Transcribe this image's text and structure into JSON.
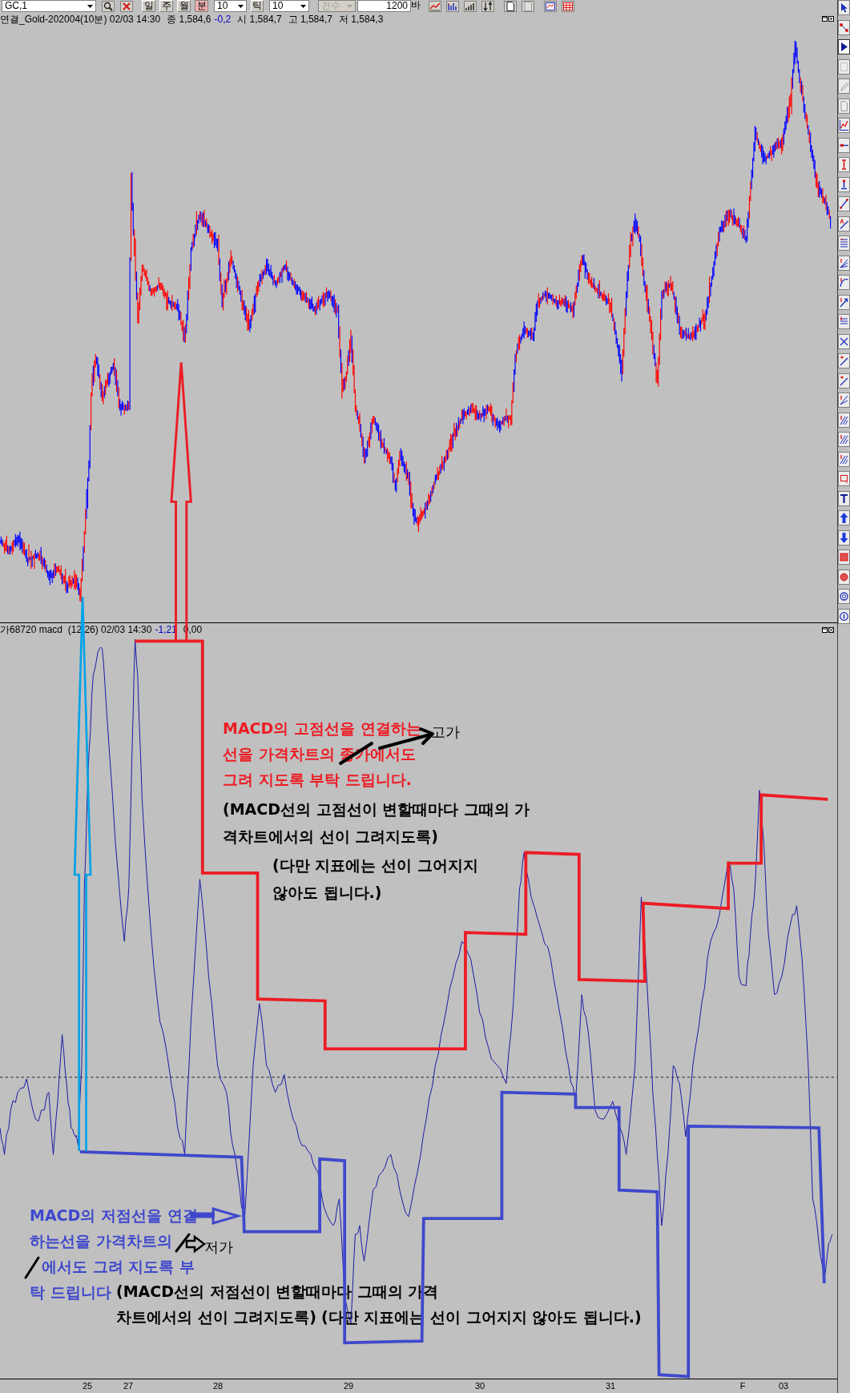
{
  "toolbar": {
    "symbol": "GC,1",
    "periods": [
      {
        "label": "일",
        "selected": false
      },
      {
        "label": "주",
        "selected": false
      },
      {
        "label": "월",
        "selected": false
      },
      {
        "label": "분",
        "selected": true
      }
    ],
    "interval": "10",
    "tick_label": "틱",
    "tick_count": "10",
    "count_mode": {
      "label": "건수",
      "disabled": true
    },
    "bar_count": "1200",
    "bar_unit": "바"
  },
  "price_panel": {
    "title": "연결_Gold-202004(10분) 02/03 14:30",
    "close": {
      "label": "종",
      "value": "1,584,6",
      "change": "-0,2"
    },
    "quotes": [
      {
        "label": "시",
        "value": "1,584,7"
      },
      {
        "label": "고",
        "value": "1,584,7"
      },
      {
        "label": "저",
        "value": "1,584,3"
      }
    ]
  },
  "indicator_panel": {
    "title": "가68720 macd  (12,26) 02/03 14:30",
    "value": "-1,21",
    "signal": "0,00"
  },
  "annotations": [
    {
      "kind": "note",
      "color": "#ed1c24",
      "lines": [
        "MACD의 고점선을 연결하는",
        "선을 가격차트의 종가에서도",
        "그려 지도록 부탁 드립니다."
      ]
    },
    {
      "kind": "label",
      "color": "#000000",
      "lines": [
        "고가"
      ]
    },
    {
      "kind": "note",
      "color": "#000000",
      "lines": [
        "(MACD선의 고점선이 변할때마다 그때의 가",
        "격차트에서의 선이 그려지도록)"
      ]
    },
    {
      "kind": "note",
      "color": "#000000",
      "lines": [
        "(다만 지표에는 선이 그어지지",
        "않아도 됩니다.)"
      ]
    },
    {
      "kind": "note",
      "color": "#3f48cc",
      "lines": [
        "MACD의 저점선을 연결",
        "하는선을 가격차트의",
        "에서도 그려 지도록 부",
        "탁 드립니다"
      ]
    },
    {
      "kind": "label",
      "color": "#000000",
      "lines": [
        "저가"
      ]
    },
    {
      "kind": "note",
      "color": "#000000",
      "lines": [
        "(MACD선의 저점선이 변할때마다 그때의 가격",
        "차트에서의 선이 그려지도록)"
      ]
    },
    {
      "kind": "note",
      "color": "#000000",
      "lines": [
        "(다만 지표에는 선이 그어지지 않아도 됩니다.)"
      ]
    }
  ],
  "x_axis": {
    "labels": [
      "25",
      "27",
      "28",
      "29",
      "30",
      "31",
      "F",
      "03"
    ]
  }
}
